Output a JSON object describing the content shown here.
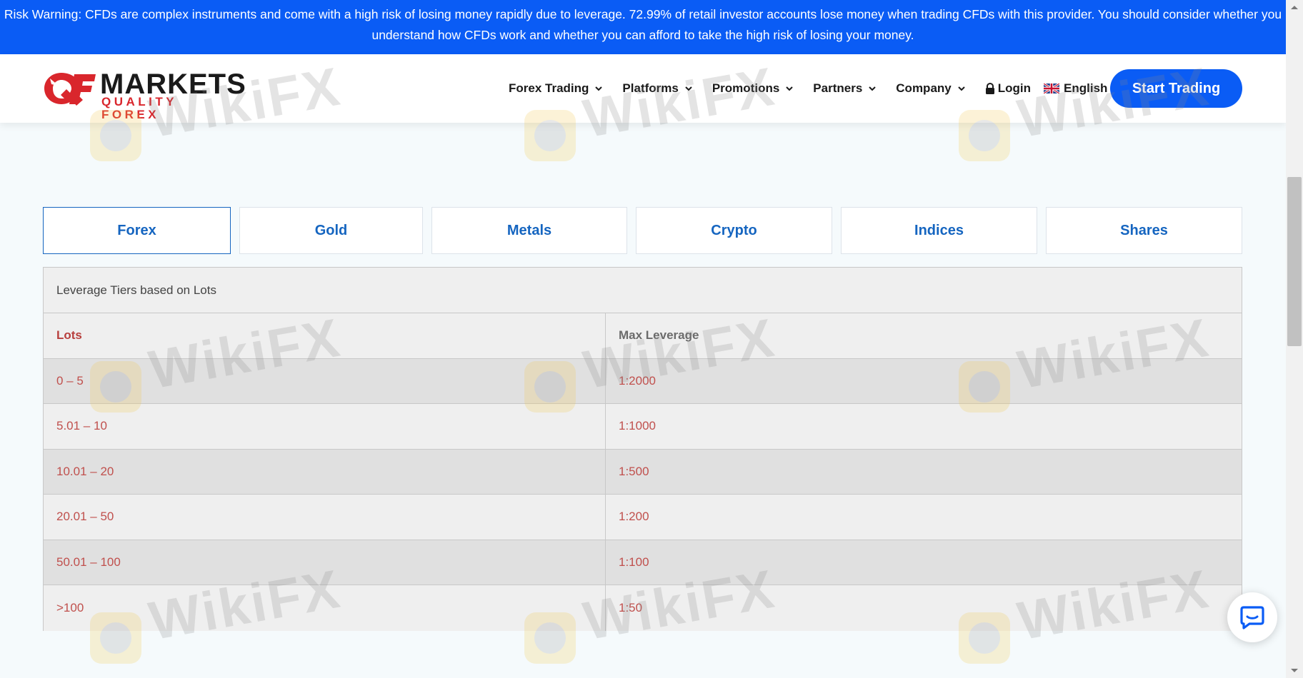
{
  "risk_warning": "Risk Warning: CFDs are complex instruments and come with a high risk of losing money rapidly due to leverage. 72.99% of retail investor accounts lose money when trading CFDs with this provider. You should consider whether you understand how CFDs work and whether you can afford to take the high risk of losing your money.",
  "logo": {
    "word": "MARKETS",
    "subtitle": "QUALITY FOREX",
    "brand_red": "#d9262c"
  },
  "nav": {
    "items": [
      {
        "label": "Forex Trading"
      },
      {
        "label": "Platforms"
      },
      {
        "label": "Promotions"
      },
      {
        "label": "Partners"
      },
      {
        "label": "Company"
      }
    ],
    "login": "Login",
    "language": "English",
    "cta": "Start Trading"
  },
  "tabs": [
    {
      "label": "Forex",
      "active": true
    },
    {
      "label": "Gold"
    },
    {
      "label": "Metals"
    },
    {
      "label": "Crypto"
    },
    {
      "label": "Indices"
    },
    {
      "label": "Shares"
    }
  ],
  "table": {
    "caption": "Leverage Tiers based on Lots",
    "headers": [
      "Lots",
      "Max Leverage"
    ],
    "rows": [
      [
        "0 – 5",
        "1:2000"
      ],
      [
        "5.01 – 10",
        "1:1000"
      ],
      [
        "10.01 – 20",
        "1:500"
      ],
      [
        "20.01 – 50",
        "1:200"
      ],
      [
        "50.01 – 100",
        "1:100"
      ],
      [
        ">100",
        "1:50"
      ]
    ]
  },
  "watermark": "WikiFX",
  "colors": {
    "accent": "#0a5cf5",
    "tab_text": "#1565c0",
    "table_text": "#c0504d"
  }
}
